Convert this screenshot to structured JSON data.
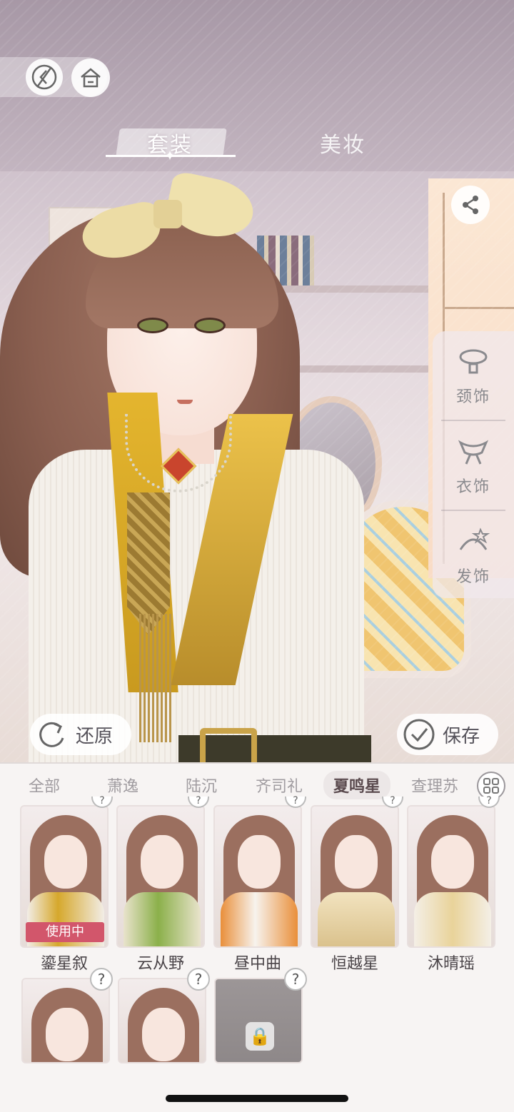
{
  "nav": {
    "back_icon": "back-arrow-icon",
    "home_icon": "home-icon"
  },
  "tabs": [
    {
      "label": "套装",
      "active": true
    },
    {
      "label": "美妆",
      "active": false
    }
  ],
  "share": {
    "icon": "share-icon"
  },
  "accessories": [
    {
      "label": "颈饰",
      "icon": "necklace-icon"
    },
    {
      "label": "衣饰",
      "icon": "scarf-icon"
    },
    {
      "label": "发饰",
      "icon": "hair-clip-icon"
    }
  ],
  "actions": {
    "revert_label": "还原",
    "save_label": "保存"
  },
  "filters": [
    {
      "label": "全部",
      "active": false
    },
    {
      "label": "萧逸",
      "active": false
    },
    {
      "label": "陆沉",
      "active": false
    },
    {
      "label": "齐司礼",
      "active": false
    },
    {
      "label": "夏鸣星",
      "active": true
    },
    {
      "label": "查理苏",
      "active": false
    }
  ],
  "outfits_row1": [
    {
      "name": "鎏星叙",
      "status": "使用中",
      "hint": "?"
    },
    {
      "name": "云从野",
      "hint": "?"
    },
    {
      "name": "昼中曲",
      "hint": "?"
    },
    {
      "name": "恒越星",
      "hint": "?"
    },
    {
      "name": "沐晴瑶",
      "hint": "?"
    }
  ],
  "outfits_row2": [
    {
      "hint": "?"
    },
    {
      "hint": "?"
    },
    {
      "hint": "?",
      "locked": true
    }
  ],
  "colors": {
    "accent": "#d2566b",
    "panel_bg": "#f7f4f3"
  }
}
